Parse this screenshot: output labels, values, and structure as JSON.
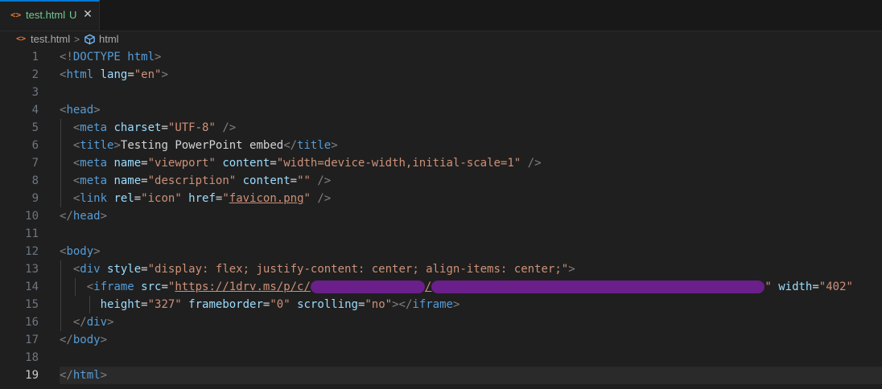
{
  "tab": {
    "icon": "<>",
    "filename": "test.html",
    "status": "U",
    "close": "✕"
  },
  "breadcrumb": {
    "file_icon": "<>",
    "file": "test.html",
    "separator": ">",
    "symbol": "html"
  },
  "lines": [
    {
      "n": "1",
      "tokens": [
        [
          "p",
          "<!"
        ],
        [
          "g",
          "DOCTYPE html"
        ],
        [
          "p",
          ">"
        ]
      ]
    },
    {
      "n": "2",
      "tokens": [
        [
          "p",
          "<"
        ],
        [
          "g",
          "html"
        ],
        [
          "a",
          " lang"
        ],
        [
          "t",
          "="
        ],
        [
          "s",
          "\"en\""
        ],
        [
          "p",
          ">"
        ]
      ]
    },
    {
      "n": "3",
      "tokens": []
    },
    {
      "n": "4",
      "tokens": [
        [
          "p",
          "<"
        ],
        [
          "g",
          "head"
        ],
        [
          "p",
          ">"
        ]
      ]
    },
    {
      "n": "5",
      "tokens": [
        [
          "t",
          "  "
        ],
        [
          "p",
          "<"
        ],
        [
          "g",
          "meta"
        ],
        [
          "a",
          " charset"
        ],
        [
          "t",
          "="
        ],
        [
          "s",
          "\"UTF-8\""
        ],
        [
          "t",
          " "
        ],
        [
          "p",
          "/>"
        ]
      ]
    },
    {
      "n": "6",
      "tokens": [
        [
          "t",
          "  "
        ],
        [
          "p",
          "<"
        ],
        [
          "g",
          "title"
        ],
        [
          "p",
          ">"
        ],
        [
          "t",
          "Testing PowerPoint embed"
        ],
        [
          "p",
          "</"
        ],
        [
          "g",
          "title"
        ],
        [
          "p",
          ">"
        ]
      ]
    },
    {
      "n": "7",
      "tokens": [
        [
          "t",
          "  "
        ],
        [
          "p",
          "<"
        ],
        [
          "g",
          "meta"
        ],
        [
          "a",
          " name"
        ],
        [
          "t",
          "="
        ],
        [
          "s",
          "\"viewport\""
        ],
        [
          "a",
          " content"
        ],
        [
          "t",
          "="
        ],
        [
          "s",
          "\"width=device-width,initial-scale=1\""
        ],
        [
          "t",
          " "
        ],
        [
          "p",
          "/>"
        ]
      ]
    },
    {
      "n": "8",
      "tokens": [
        [
          "t",
          "  "
        ],
        [
          "p",
          "<"
        ],
        [
          "g",
          "meta"
        ],
        [
          "a",
          " name"
        ],
        [
          "t",
          "="
        ],
        [
          "s",
          "\"description\""
        ],
        [
          "a",
          " content"
        ],
        [
          "t",
          "="
        ],
        [
          "s",
          "\"\""
        ],
        [
          "t",
          " "
        ],
        [
          "p",
          "/>"
        ]
      ]
    },
    {
      "n": "9",
      "tokens": [
        [
          "t",
          "  "
        ],
        [
          "p",
          "<"
        ],
        [
          "g",
          "link"
        ],
        [
          "a",
          " rel"
        ],
        [
          "t",
          "="
        ],
        [
          "s",
          "\"icon\""
        ],
        [
          "a",
          " href"
        ],
        [
          "t",
          "="
        ],
        [
          "s",
          "\""
        ],
        [
          "u",
          "favicon.png"
        ],
        [
          "s",
          "\""
        ],
        [
          "t",
          " "
        ],
        [
          "p",
          "/>"
        ]
      ]
    },
    {
      "n": "10",
      "tokens": [
        [
          "p",
          "</"
        ],
        [
          "g",
          "head"
        ],
        [
          "p",
          ">"
        ]
      ]
    },
    {
      "n": "11",
      "tokens": []
    },
    {
      "n": "12",
      "tokens": [
        [
          "p",
          "<"
        ],
        [
          "g",
          "body"
        ],
        [
          "p",
          ">"
        ]
      ]
    },
    {
      "n": "13",
      "tokens": [
        [
          "t",
          "  "
        ],
        [
          "p",
          "<"
        ],
        [
          "g",
          "div"
        ],
        [
          "a",
          " style"
        ],
        [
          "t",
          "="
        ],
        [
          "s",
          "\"display: flex; justify-content: center; align-items: center;\""
        ],
        [
          "p",
          ">"
        ]
      ]
    },
    {
      "n": "14",
      "tokens": [
        [
          "t",
          "    "
        ],
        [
          "p",
          "<"
        ],
        [
          "g",
          "iframe"
        ],
        [
          "a",
          " src"
        ],
        [
          "t",
          "="
        ],
        [
          "s",
          "\""
        ],
        [
          "u",
          "https://1drv.ms/p/c/"
        ],
        [
          "r1",
          ""
        ],
        [
          "u",
          "/"
        ],
        [
          "r2",
          ""
        ],
        [
          "s",
          "\""
        ],
        [
          "a",
          " width"
        ],
        [
          "t",
          "="
        ],
        [
          "s",
          "\"402\""
        ]
      ]
    },
    {
      "n": "15",
      "tokens": [
        [
          "t",
          "      "
        ],
        [
          "a",
          "height"
        ],
        [
          "t",
          "="
        ],
        [
          "s",
          "\"327\""
        ],
        [
          "a",
          " frameborder"
        ],
        [
          "t",
          "="
        ],
        [
          "s",
          "\"0\""
        ],
        [
          "a",
          " scrolling"
        ],
        [
          "t",
          "="
        ],
        [
          "s",
          "\"no\""
        ],
        [
          "p",
          "></"
        ],
        [
          "g",
          "iframe"
        ],
        [
          "p",
          ">"
        ]
      ]
    },
    {
      "n": "16",
      "tokens": [
        [
          "t",
          "  "
        ],
        [
          "p",
          "</"
        ],
        [
          "g",
          "div"
        ],
        [
          "p",
          ">"
        ]
      ]
    },
    {
      "n": "17",
      "tokens": [
        [
          "p",
          "</"
        ],
        [
          "g",
          "body"
        ],
        [
          "p",
          ">"
        ]
      ]
    },
    {
      "n": "18",
      "tokens": []
    },
    {
      "n": "19",
      "tokens": [
        [
          "p",
          "</"
        ],
        [
          "g",
          "html"
        ],
        [
          "p",
          ">"
        ]
      ],
      "current": true
    }
  ],
  "colors": {
    "tag": "#569cd6",
    "attribute": "#9cdcfe",
    "string": "#ce9178",
    "redaction": "#6a1f8a",
    "accent": "#0078d4"
  }
}
